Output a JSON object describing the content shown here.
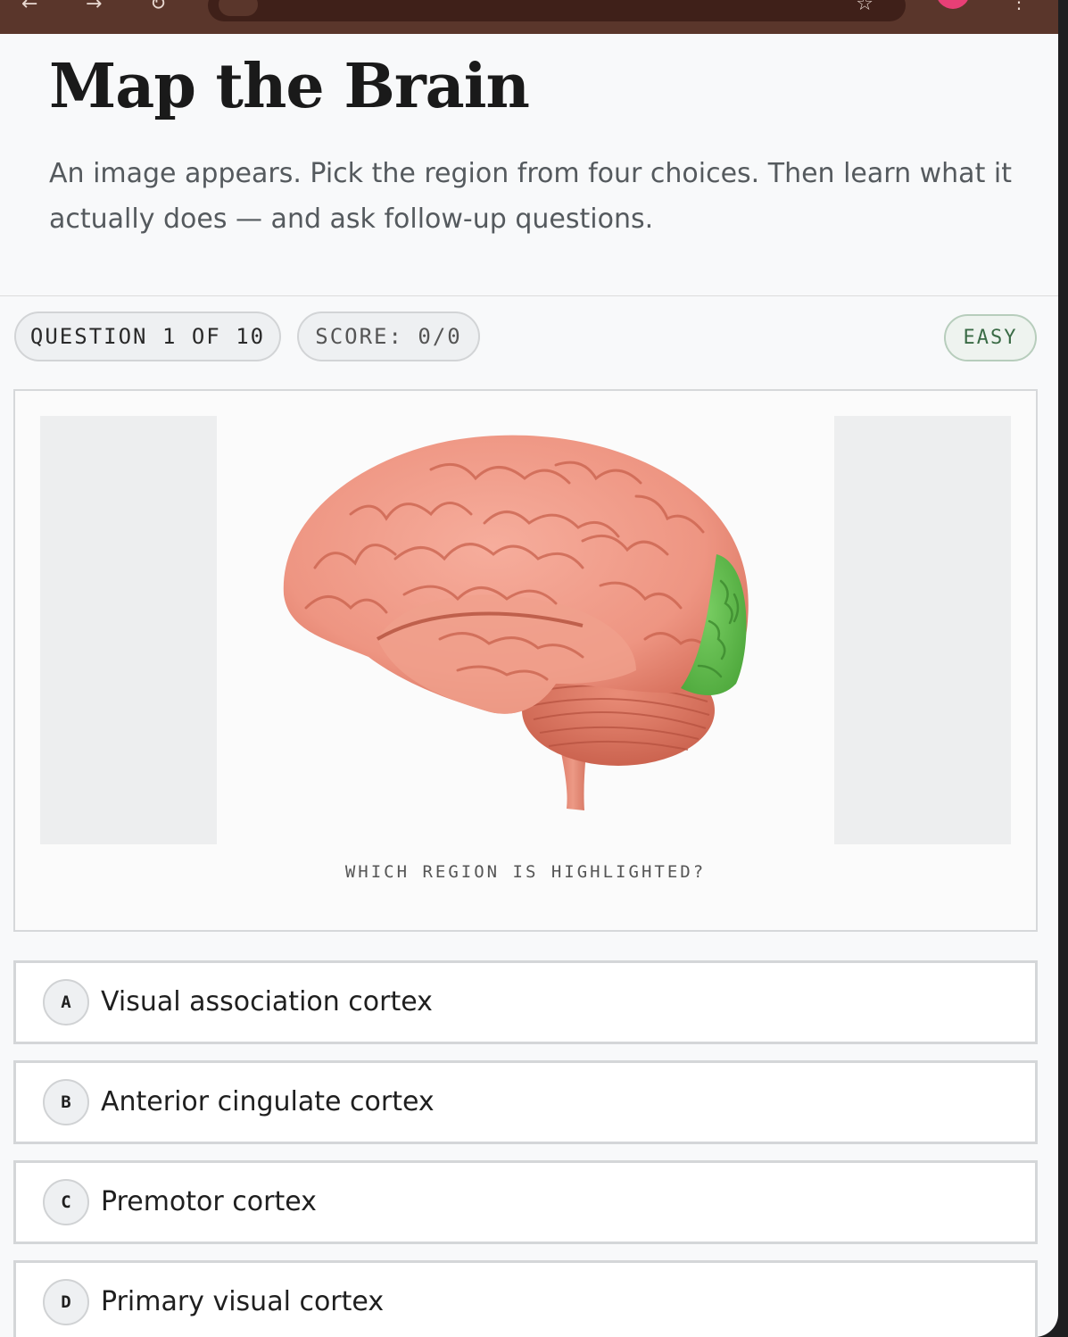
{
  "browser": {
    "back_glyph": "←",
    "forward_glyph": "→",
    "reload_glyph": "↻",
    "star_glyph": "☆",
    "menu_glyph": "⋮"
  },
  "hero": {
    "title": "Map the Brain",
    "subtitle": "An image appears. Pick the region from four choices. Then learn what it actually does — and ask follow-up questions."
  },
  "status": {
    "question": "QUESTION 1 OF 10",
    "score": "SCORE: 0/0",
    "difficulty": "EASY"
  },
  "quiz": {
    "prompt": "WHICH REGION IS HIGHLIGHTED?",
    "image_icon": "brain-lateral-view",
    "highlight_color": "#5cb84a",
    "brain_color": "#ee9582",
    "options": [
      {
        "letter": "A",
        "text": "Visual association cortex"
      },
      {
        "letter": "B",
        "text": "Anterior cingulate cortex"
      },
      {
        "letter": "C",
        "text": "Premotor cortex"
      },
      {
        "letter": "D",
        "text": "Primary visual cortex"
      }
    ]
  },
  "colors": {
    "browser_bar": "#5a362b",
    "page_background": "#f8f9fa",
    "easy_text": "#3a6b46"
  }
}
